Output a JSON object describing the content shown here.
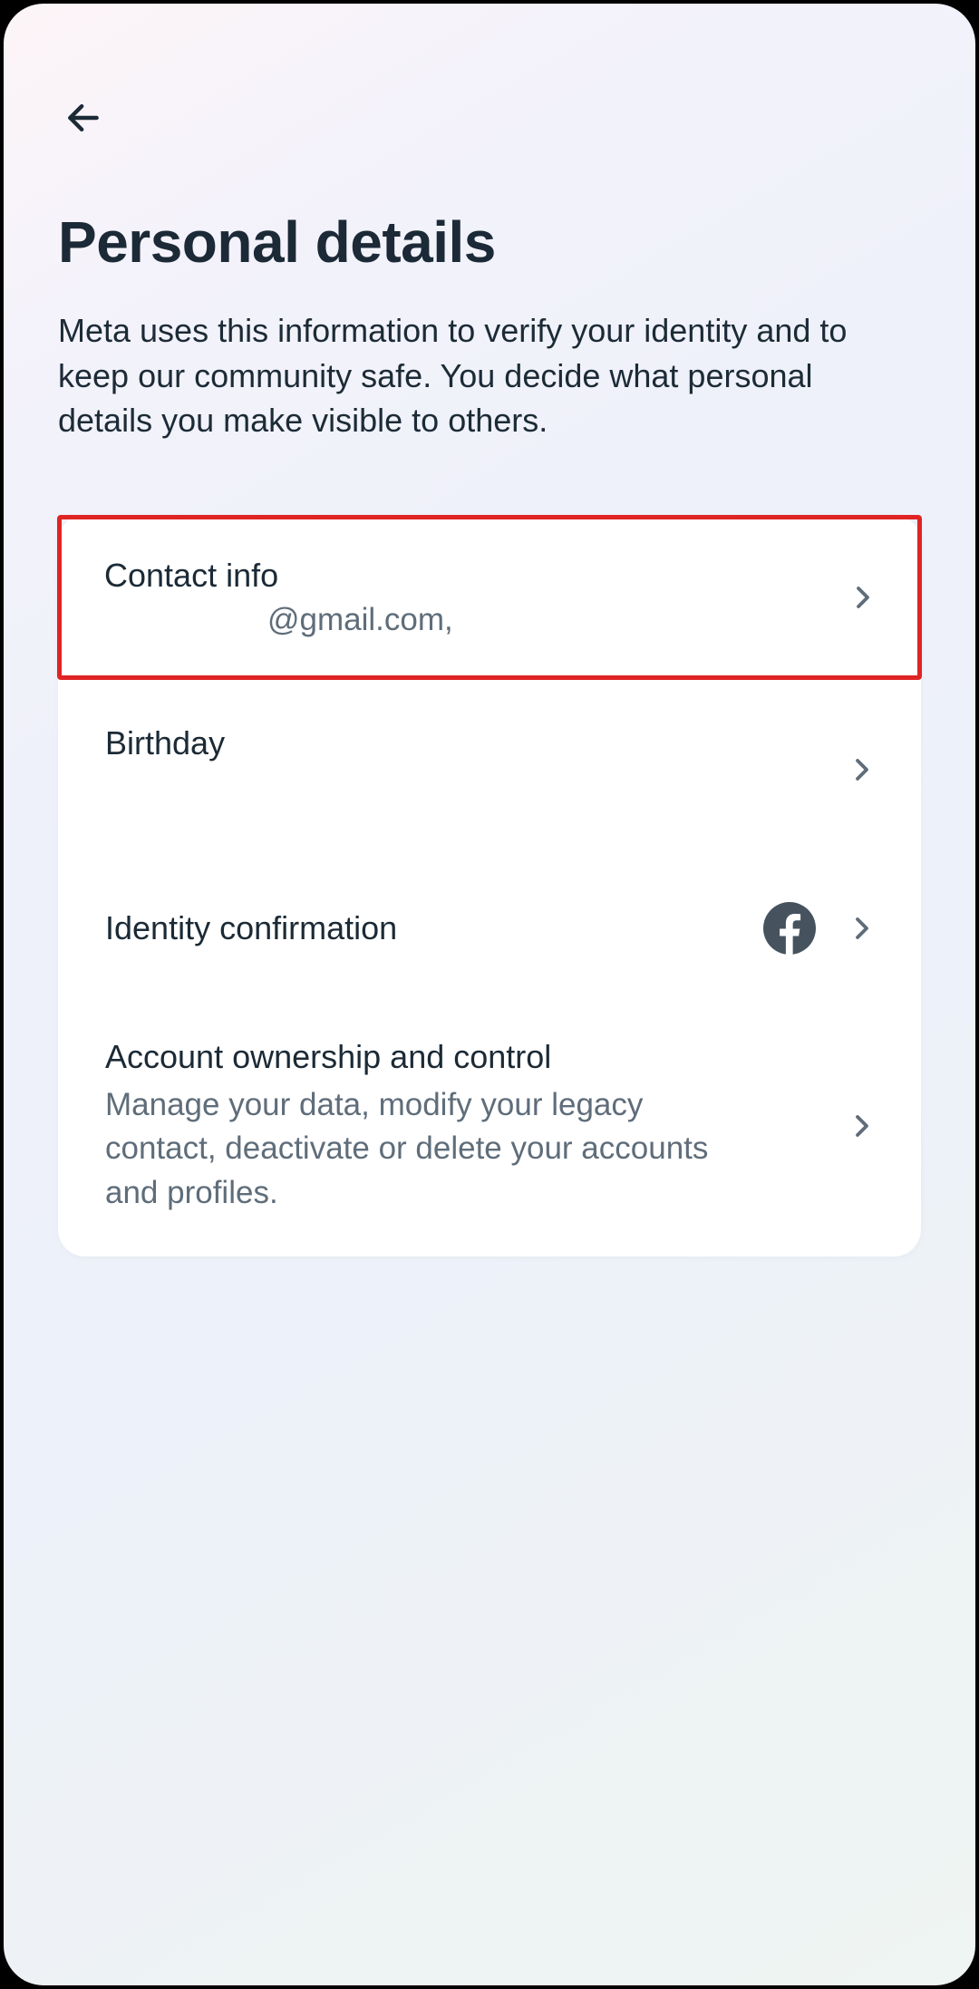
{
  "header": {
    "title": "Personal details",
    "description": "Meta uses this information to verify your identity and to keep our community safe. You decide what personal details you make visible to others."
  },
  "rows": {
    "contact": {
      "title": "Contact info",
      "subtitle": "@gmail.com,"
    },
    "birthday": {
      "title": "Birthday"
    },
    "identity": {
      "title": "Identity confirmation"
    },
    "ownership": {
      "title": "Account ownership and control",
      "description": "Manage your data, modify your legacy contact, deactivate or delete your accounts and profiles."
    }
  }
}
